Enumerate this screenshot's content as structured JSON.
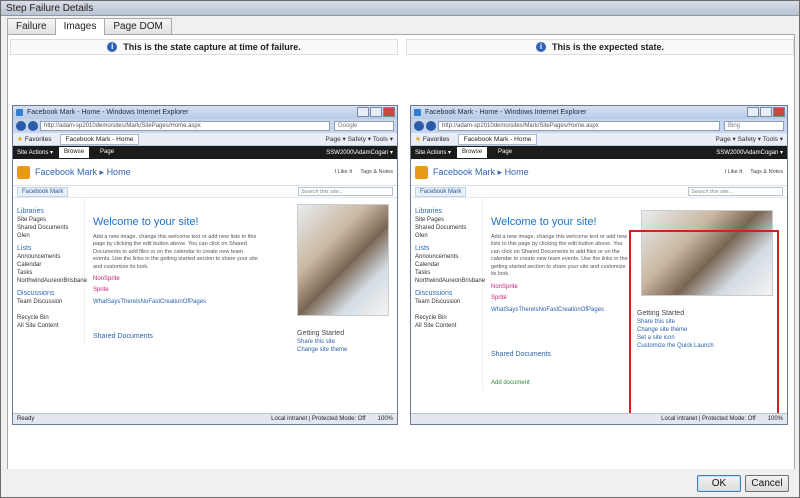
{
  "window": {
    "title": "Step Failure Details"
  },
  "tabs": [
    {
      "label": "Failure"
    },
    {
      "label": "Images"
    },
    {
      "label": "Page DOM"
    }
  ],
  "left_panel": {
    "header": "This is the state capture at time of failure.",
    "browser": {
      "title": "Facebook Mark - Home - Windows Internet Explorer",
      "address": "http://adam-sp2010demo/sites/Mark/SitePages/Home.aspx",
      "search": "Google",
      "favorites": "Favorites",
      "fav_tab": "Facebook Mark - Home",
      "commands": "Page ▾  Safety ▾  Tools ▾",
      "site_actions": "Site Actions ▾",
      "ribbon_tabs": [
        "Browse",
        "Page"
      ],
      "user": "SSW2000\\AdamCogan ▾",
      "site_title": "Facebook Mark",
      "site_sub": "Home",
      "like": "I Like It",
      "tags": "Tags & Notes",
      "topnav_link": "Facebook Mark",
      "search_placeholder": "Search this site...",
      "quick_launch": {
        "libraries": "Libraries",
        "lib_items": [
          "Site Pages",
          "Shared Documents",
          "Glen"
        ],
        "lists": "Lists",
        "list_items": [
          "Announcements",
          "Calendar",
          "Tasks",
          "NorthwindAureonBrisbane"
        ],
        "discussions": "Discussions",
        "disc_items": [
          "Team Discussion"
        ],
        "recycle": "Recycle Bin",
        "all_content": "All Site Content"
      },
      "welcome": "Welcome to your site!",
      "paragraph": "Add a new image, change this welcome text or add new lists to this page by clicking the edit button above. You can click on Shared Documents to add files or on the calendar to create new team events. Use the links in the getting started section to share your site and customize its look.",
      "pink1": "NonSprite",
      "pink2": "Sprite",
      "link": "WhatSaysThereIsNoFastCreationOfPages",
      "getting_started": "Getting Started",
      "gs_items": [
        "Share this site",
        "Change site theme"
      ],
      "shared_documents": "Shared Documents",
      "status_ready": "Ready",
      "status_zone": "Local intranet | Protected Mode: Off",
      "zoom": "100%"
    }
  },
  "right_panel": {
    "header": "This is the expected state.",
    "browser": {
      "title": "Facebook Mark - Home - Windows Internet Explorer",
      "address": "http://adam-sp2010demo/sites/Mark/SitePages/Home.aspx",
      "search": "Bing",
      "favorites": "Favorites",
      "fav_tab": "Facebook Mark - Home",
      "commands": "Page ▾  Safety ▾  Tools ▾",
      "site_actions": "Site Actions ▾",
      "ribbon_tabs": [
        "Browse",
        "Page"
      ],
      "user": "SSW2000\\AdamCogan ▾",
      "site_title": "Facebook Mark",
      "site_sub": "Home",
      "like": "I Like It",
      "tags": "Tags & Notes",
      "topnav_link": "Facebook Mark",
      "search_placeholder": "Search this site...",
      "quick_launch": {
        "libraries": "Libraries",
        "lib_items": [
          "Site Pages",
          "Shared Documents",
          "Glen"
        ],
        "lists": "Lists",
        "list_items": [
          "Announcements",
          "Calendar",
          "Tasks",
          "NorthwindAureonBrisbane"
        ],
        "discussions": "Discussions",
        "disc_items": [
          "Team Discussion"
        ],
        "recycle": "Recycle Bin",
        "all_content": "All Site Content"
      },
      "welcome": "Welcome to your site!",
      "paragraph": "Add a new image, change this welcome text or add new lists to this page by clicking the edit button above. You can click on Shared Documents to add files or on the calendar to create new team events. Use the links in the getting started section to share your site and customize its look.",
      "pink1": "NonSprite",
      "pink2": "Sprite",
      "link": "WhatSaysThereIsNoFastCreationOfPages",
      "getting_started": "Getting Started",
      "gs_items": [
        "Share this site",
        "Change site theme",
        "Set a site icon",
        "Customize the Quick Launch"
      ],
      "shared_documents": "Shared Documents",
      "add_document": "Add document",
      "status_ready": "",
      "status_zone": "Local intranet | Protected Mode: Off",
      "zoom": "100%"
    }
  },
  "buttons": {
    "ok": "OK",
    "cancel": "Cancel"
  }
}
